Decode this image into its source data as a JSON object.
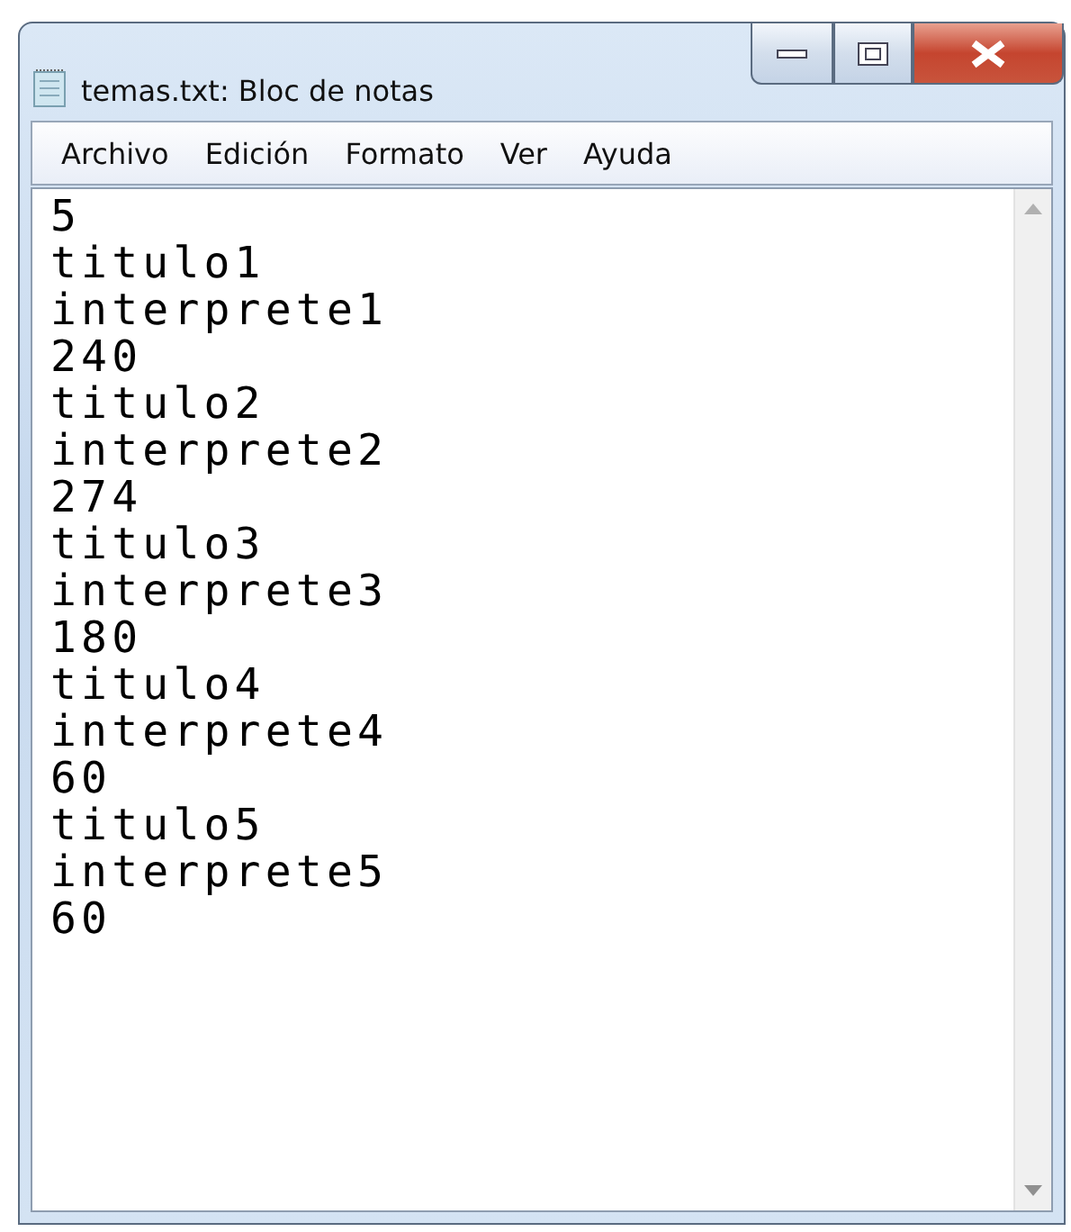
{
  "window": {
    "title": "temas.txt: Bloc de notas"
  },
  "menu": [
    "Archivo",
    "Edición",
    "Formato",
    "Ver",
    "Ayuda"
  ],
  "editor": {
    "lines": [
      "5",
      "titulo1",
      "interprete1",
      "240",
      "titulo2",
      "interprete2",
      "274",
      "titulo3",
      "interprete3",
      "180",
      "titulo4",
      "interprete4",
      "60",
      "titulo5",
      "interprete5",
      "60"
    ]
  }
}
